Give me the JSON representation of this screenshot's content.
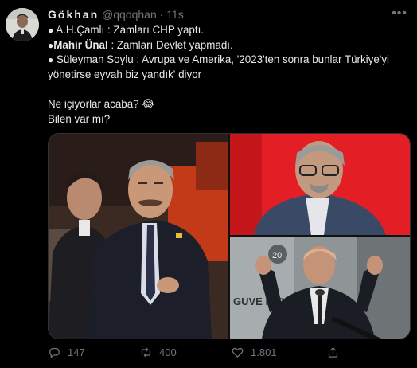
{
  "author": {
    "name": "Gökhan",
    "handle": "@qqoqhan",
    "separator": "·",
    "time": "11s"
  },
  "tweet": {
    "lines": [
      {
        "bullet": "●",
        "bold": "",
        "text": "A.H.Çamlı : Zamları CHP yaptı."
      },
      {
        "bullet": "●",
        "bold": "Mahir Ünal",
        "text": ": Zamları Devlet yapmadı."
      },
      {
        "bullet": "●",
        "bold": "",
        "text": "Süleyman Soylu : Avrupa ve Amerika, '2023'ten sonra bunlar Türkiye'yi"
      },
      {
        "bullet": "",
        "bold": "",
        "text": "yönetirse eyvah biz yandık' diyor"
      },
      {
        "bullet": "",
        "bold": "",
        "text": ""
      },
      {
        "bullet": "",
        "bold": "",
        "text": "Ne içiyorlar acaba? 😂"
      },
      {
        "bullet": "",
        "bold": "",
        "text": "Bilen var mı?"
      }
    ]
  },
  "media": {
    "photo3_sign": "GUVE ISTIK",
    "photo3_badge": "20"
  },
  "actions": {
    "reply_count": "147",
    "retweet_count": "400",
    "like_count": "1.801"
  },
  "icons": {
    "more": "more-icon",
    "reply": "reply-icon",
    "retweet": "retweet-icon",
    "like": "like-icon",
    "share": "share-icon"
  },
  "colors": {
    "background": "#000000",
    "text": "#e7e9ea",
    "muted": "#71767b",
    "photo2_bg": "#e31e24"
  }
}
